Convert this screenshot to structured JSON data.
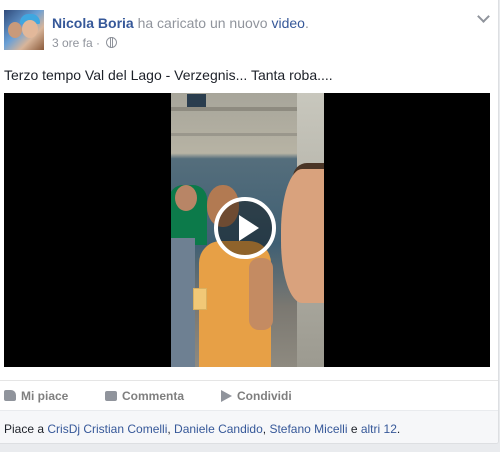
{
  "post": {
    "author": "Nicola Boria",
    "action_text": " ha caricato un nuovo ",
    "action_link": "video",
    "action_end": ".",
    "time": "3 ore fa",
    "separator": " · ",
    "audience_icon": "globe-icon",
    "menu_icon": "chevron-down-icon",
    "message": "Terzo tempo Val del Lago - Verzegnis... Tanta roba....",
    "video": {
      "play_icon": "play-icon"
    }
  },
  "actions": {
    "like": {
      "label": "Mi piace",
      "icon": "thumbs-up-icon"
    },
    "comment": {
      "label": "Commenta",
      "icon": "comment-icon"
    },
    "share": {
      "label": "Condividi",
      "icon": "share-arrow-icon"
    }
  },
  "likes": {
    "prefix": "Piace a ",
    "people": [
      "CrisDj Cristian Comelli",
      "Daniele Candido",
      "Stefano Micelli"
    ],
    "sep1": ", ",
    "sep2": ", ",
    "conj": " e ",
    "others": "altri 12",
    "suffix": "."
  },
  "colors": {
    "link": "#365899",
    "meta": "#90949c",
    "text": "#1d2129",
    "background": "#e9ebee"
  }
}
